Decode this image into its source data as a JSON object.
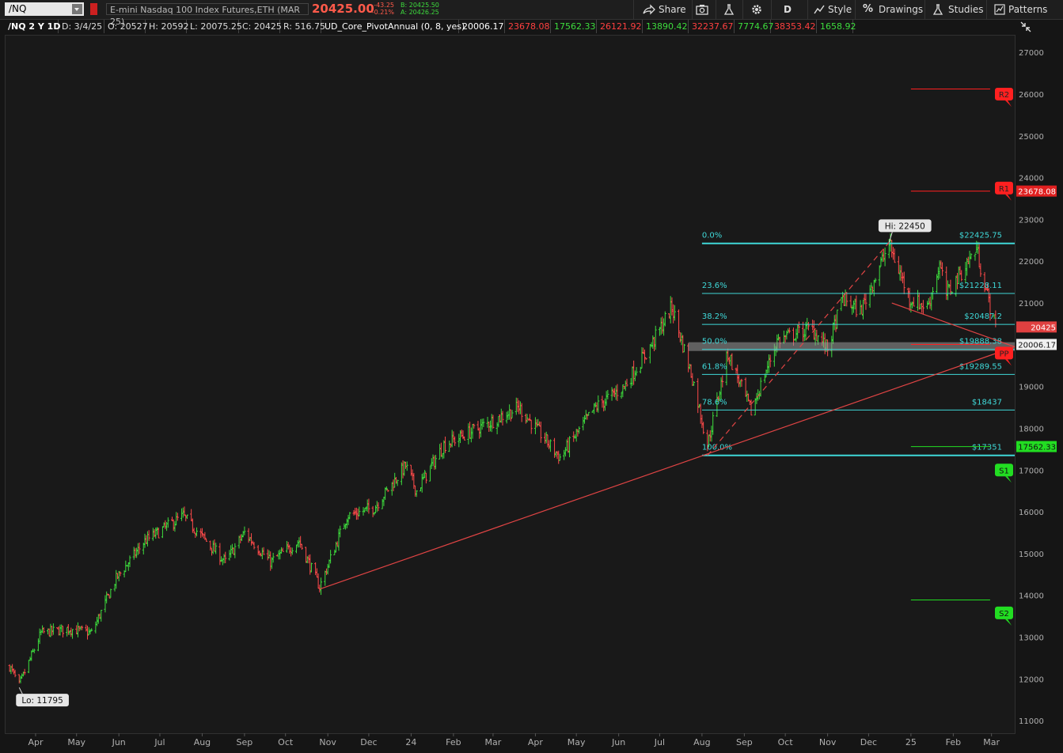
{
  "toolbar": {
    "symbol": "/NQ",
    "description": "E-mini Nasdaq 100 Index Futures,ETH (MAR 25)",
    "last_price": "20425.00",
    "net_change": "-43.25",
    "pct_change": "-0.21%",
    "bid": "B: 20425.50",
    "ask": "A: 20426.25",
    "share_label": "Share",
    "aggregation_label": "D",
    "style_label": "Style",
    "drawings_label": "Drawings",
    "studies_label": "Studies",
    "patterns_label": "Patterns"
  },
  "info_bar": {
    "title": "/NQ 2 Y 1D",
    "date": "D: 3/4/25",
    "open": "O: 20527",
    "high": "H: 20592",
    "low": "L: 20075.25",
    "close": "C: 20425",
    "range": "R: 516.75",
    "study": "UD_Core_PivotAnnual (0, 8, yes)",
    "study_values": [
      {
        "text": "20006.17",
        "color": "#ffffff"
      },
      {
        "text": "23678.08",
        "color": "#ff4040"
      },
      {
        "text": "17562.33",
        "color": "#3ddc3d"
      },
      {
        "text": "26121.92",
        "color": "#ff4040"
      },
      {
        "text": "13890.42",
        "color": "#3ddc3d"
      },
      {
        "text": "32237.67",
        "color": "#ff4040"
      },
      {
        "text": "7774.67",
        "color": "#3ddc3d"
      },
      {
        "text": "38353.42",
        "color": "#ff4040"
      },
      {
        "text": "1658.92",
        "color": "#3ddc3d"
      }
    ]
  },
  "colors": {
    "up": "#3ddc3d",
    "down": "#ff4a4a",
    "fib": "#3fd8d8",
    "trendline": "#e04444",
    "axis_text": "#b0b0b0"
  },
  "chart_data": {
    "type": "candlestick",
    "symbol": "/NQ",
    "timeframe": "2 Y 1D",
    "ylim": [
      10700,
      27400
    ],
    "y_ticks": [
      11000,
      12000,
      13000,
      14000,
      15000,
      16000,
      17000,
      18000,
      19000,
      20000,
      21000,
      22000,
      23000,
      24000,
      25000,
      26000,
      27000
    ],
    "x_range": [
      "2023-03-10",
      "2025-03-18"
    ],
    "x_ticks": [
      {
        "label": "Apr",
        "date": "2023-04-01"
      },
      {
        "label": "May",
        "date": "2023-05-01"
      },
      {
        "label": "Jun",
        "date": "2023-06-01"
      },
      {
        "label": "Jul",
        "date": "2023-07-01"
      },
      {
        "label": "Aug",
        "date": "2023-08-01"
      },
      {
        "label": "Sep",
        "date": "2023-09-01"
      },
      {
        "label": "Oct",
        "date": "2023-10-01"
      },
      {
        "label": "Nov",
        "date": "2023-11-01"
      },
      {
        "label": "Dec",
        "date": "2023-12-01"
      },
      {
        "label": "24",
        "date": "2024-01-01"
      },
      {
        "label": "Feb",
        "date": "2024-02-01"
      },
      {
        "label": "Mar",
        "date": "2024-03-01"
      },
      {
        "label": "Apr",
        "date": "2024-04-01"
      },
      {
        "label": "May",
        "date": "2024-05-01"
      },
      {
        "label": "Jun",
        "date": "2024-06-01"
      },
      {
        "label": "Jul",
        "date": "2024-07-01"
      },
      {
        "label": "Aug",
        "date": "2024-08-01"
      },
      {
        "label": "Sep",
        "date": "2024-09-01"
      },
      {
        "label": "Oct",
        "date": "2024-10-01"
      },
      {
        "label": "Nov",
        "date": "2024-11-01"
      },
      {
        "label": "Dec",
        "date": "2024-12-01"
      },
      {
        "label": "25",
        "date": "2025-01-01"
      },
      {
        "label": "Feb",
        "date": "2025-02-01"
      },
      {
        "label": "Mar",
        "date": "2025-03-01"
      }
    ],
    "price_path": [
      {
        "date": "2023-03-13",
        "close": 12300
      },
      {
        "date": "2023-03-20",
        "close": 11850
      },
      {
        "date": "2023-04-05",
        "close": 13100
      },
      {
        "date": "2023-04-25",
        "close": 13200
      },
      {
        "date": "2023-05-12",
        "close": 13100
      },
      {
        "date": "2023-05-30",
        "close": 14400
      },
      {
        "date": "2023-06-20",
        "close": 15300
      },
      {
        "date": "2023-07-18",
        "close": 15900
      },
      {
        "date": "2023-08-18",
        "close": 14800
      },
      {
        "date": "2023-09-01",
        "close": 15500
      },
      {
        "date": "2023-09-20",
        "close": 14800
      },
      {
        "date": "2023-10-11",
        "close": 15300
      },
      {
        "date": "2023-10-26",
        "close": 14200
      },
      {
        "date": "2023-11-15",
        "close": 15900
      },
      {
        "date": "2023-12-05",
        "close": 16100
      },
      {
        "date": "2023-12-28",
        "close": 17100
      },
      {
        "date": "2024-01-05",
        "close": 16500
      },
      {
        "date": "2024-01-25",
        "close": 17600
      },
      {
        "date": "2024-02-25",
        "close": 18100
      },
      {
        "date": "2024-03-20",
        "close": 18500
      },
      {
        "date": "2024-04-19",
        "close": 17300
      },
      {
        "date": "2024-05-15",
        "close": 18500
      },
      {
        "date": "2024-06-05",
        "close": 19000
      },
      {
        "date": "2024-06-25",
        "close": 20000
      },
      {
        "date": "2024-07-10",
        "close": 20900
      },
      {
        "date": "2024-07-25",
        "close": 19200
      },
      {
        "date": "2024-08-05",
        "close": 17600
      },
      {
        "date": "2024-08-20",
        "close": 19800
      },
      {
        "date": "2024-09-06",
        "close": 18400
      },
      {
        "date": "2024-09-25",
        "close": 20100
      },
      {
        "date": "2024-10-20",
        "close": 20400
      },
      {
        "date": "2024-11-01",
        "close": 19900
      },
      {
        "date": "2024-11-12",
        "close": 21100
      },
      {
        "date": "2024-11-25",
        "close": 20800
      },
      {
        "date": "2024-12-16",
        "close": 22400
      },
      {
        "date": "2024-12-31",
        "close": 21100
      },
      {
        "date": "2025-01-13",
        "close": 20900
      },
      {
        "date": "2025-01-22",
        "close": 21900
      },
      {
        "date": "2025-01-27",
        "close": 21200
      },
      {
        "date": "2025-02-18",
        "close": 22300
      },
      {
        "date": "2025-02-28",
        "close": 20900
      },
      {
        "date": "2025-03-04",
        "close": 20425
      }
    ],
    "fibonacci": [
      {
        "ratio": "0.0%",
        "price_label": "$22425.75",
        "price": 22425.75
      },
      {
        "ratio": "23.6%",
        "price_label": "$21228.11",
        "price": 21228.11
      },
      {
        "ratio": "38.2%",
        "price_label": "$20487.2",
        "price": 20487.2
      },
      {
        "ratio": "50.0%",
        "price_label": "$19888.38",
        "price": 19888.38
      },
      {
        "ratio": "61.8%",
        "price_label": "$19289.55",
        "price": 19289.55
      },
      {
        "ratio": "78.6%",
        "price_label": "$18437",
        "price": 18437
      },
      {
        "ratio": "100.0%",
        "price_label": "$17351",
        "price": 17351
      }
    ],
    "fib_range": {
      "start": "2024-08-01",
      "end": "2025-03-18"
    },
    "pivots": [
      {
        "name": "R2",
        "value": 26121.92,
        "color": "#ff2020"
      },
      {
        "name": "R1",
        "value": 23678.08,
        "color": "#ff2020",
        "tag": "23678.08"
      },
      {
        "name": "PP",
        "value": 20006.17,
        "color": "#ff2020",
        "tag": "20006.17"
      },
      {
        "name": "S1",
        "value": 17562.33,
        "color": "#22dd22",
        "tag": "17562.33"
      },
      {
        "name": "S2",
        "value": 13890.42,
        "color": "#22dd22"
      }
    ],
    "pivot_line_range": {
      "start": "2025-01-01",
      "end": "2025-02-28"
    },
    "last_price_tag": "20425",
    "gray_zone": [
      19850,
      20060
    ],
    "trendlines": [
      {
        "from": {
          "date": "2023-10-26",
          "price": 14150
        },
        "to": {
          "date": "2025-03-18",
          "price": 19950
        },
        "style": "solid"
      },
      {
        "from": {
          "date": "2024-08-05",
          "price": 17351
        },
        "to": {
          "date": "2024-12-16",
          "price": 22450
        },
        "style": "dashed"
      },
      {
        "from": {
          "date": "2024-12-18",
          "price": 21000
        },
        "to": {
          "date": "2025-03-18",
          "price": 19950
        },
        "style": "solid"
      }
    ],
    "annotations": [
      {
        "text": "Hi: 22450",
        "date": "2024-12-16",
        "price": 22450
      },
      {
        "text": "Lo: 11795",
        "date": "2023-03-20",
        "price": 11795
      }
    ]
  }
}
